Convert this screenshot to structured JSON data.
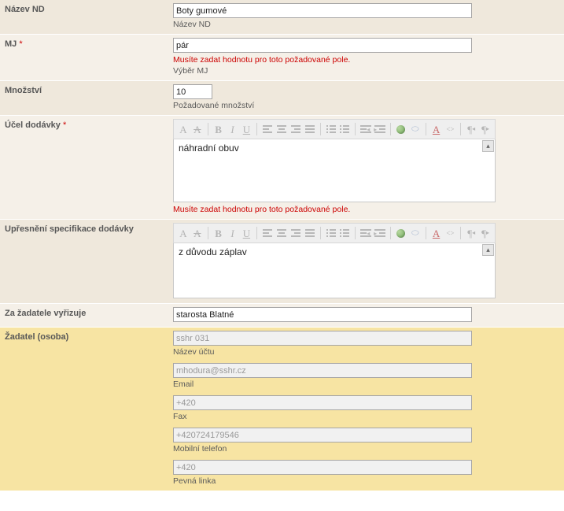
{
  "nazev_nd": {
    "label": "Název ND",
    "value": "Boty gumové",
    "hint": "Název ND"
  },
  "mj": {
    "label": "MJ",
    "required": "*",
    "value": "pár",
    "error": "Musíte zadat hodnotu pro toto požadované pole.",
    "hint": "Výběr MJ"
  },
  "mnozstvi": {
    "label": "Množství",
    "value": "10",
    "hint": "Požadované množství"
  },
  "ucel": {
    "label": "Účel dodávky",
    "required": "*",
    "value": "náhradní obuv",
    "error": "Musíte zadat hodnotu pro toto požadované pole."
  },
  "upresneni": {
    "label": "Upřesnění specifikace dodávky",
    "value": "z důvodu záplav"
  },
  "vyrizuje": {
    "label": "Za žadatele vyřizuje",
    "value": "starosta Blatné"
  },
  "zadatel": {
    "label": "Žadatel (osoba)",
    "ucet": {
      "value": "sshr 031",
      "hint": "Název účtu"
    },
    "email": {
      "value": "mhodura@sshr.cz",
      "hint": "Email"
    },
    "fax": {
      "value": "+420",
      "hint": "Fax"
    },
    "mobil": {
      "value": "+420724179546",
      "hint": "Mobilní telefon"
    },
    "linka": {
      "value": "+420",
      "hint": "Pevná linka"
    }
  },
  "toolbar": {
    "font_fg": "A",
    "font_bg": "A",
    "bold": "B",
    "italic": "I",
    "underline": "U",
    "remove_format": "A",
    "ltr": "¶",
    "rtl": "¶"
  }
}
